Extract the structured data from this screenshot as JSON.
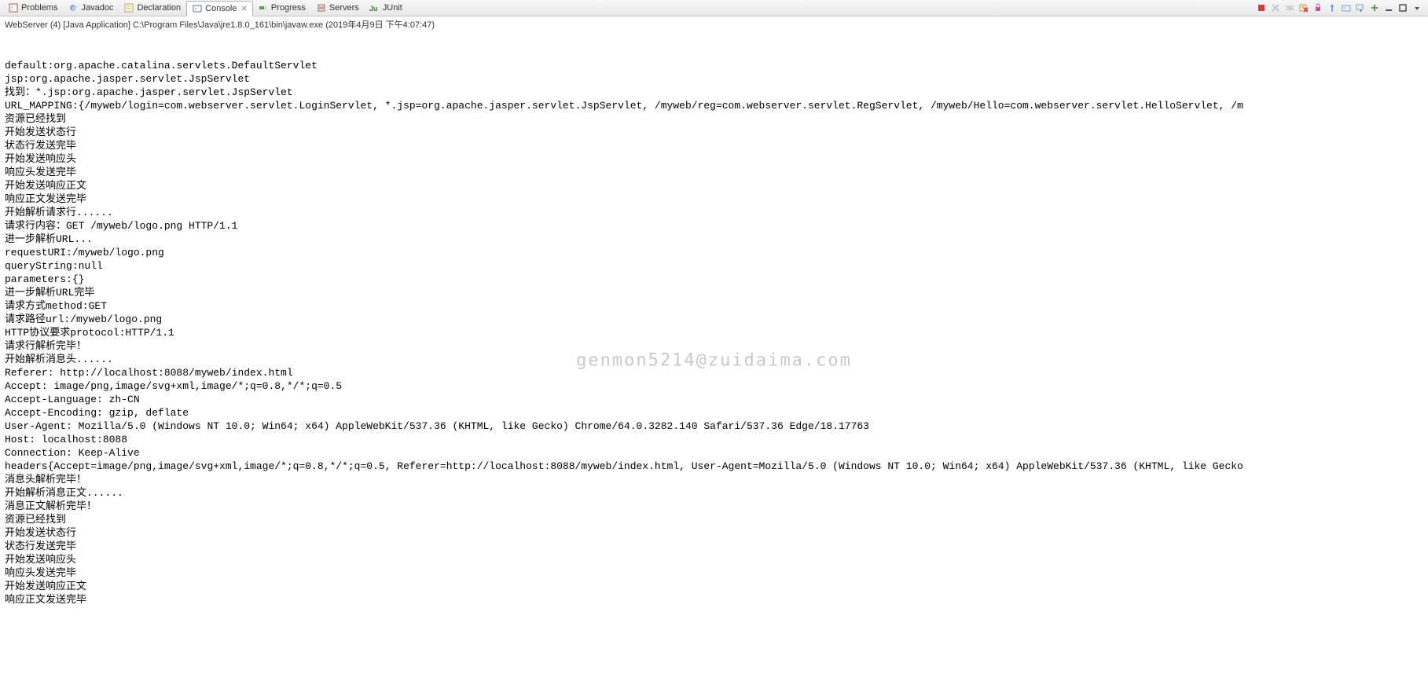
{
  "tabs": [
    {
      "label": "Problems",
      "icon": "problems-icon"
    },
    {
      "label": "Javadoc",
      "icon": "javadoc-icon"
    },
    {
      "label": "Declaration",
      "icon": "declaration-icon"
    },
    {
      "label": "Console",
      "icon": "console-icon",
      "active": true,
      "closable": true
    },
    {
      "label": "Progress",
      "icon": "progress-icon"
    },
    {
      "label": "Servers",
      "icon": "servers-icon"
    },
    {
      "label": "JUnit",
      "icon": "junit-icon"
    }
  ],
  "launch": {
    "title_prefix": "WebServer (4) [Java Application]",
    "path": "C:\\Program Files\\Java\\jre1.8.0_161\\bin\\javaw.exe",
    "timestamp": "(2019年4月9日 下午4:07:47)"
  },
  "console_lines": [
    "default:org.apache.catalina.servlets.DefaultServlet",
    "jsp:org.apache.jasper.servlet.JspServlet",
    "找到：*.jsp:org.apache.jasper.servlet.JspServlet",
    "URL_MAPPING:{/myweb/login=com.webserver.servlet.LoginServlet, *.jsp=org.apache.jasper.servlet.JspServlet, /myweb/reg=com.webserver.servlet.RegServlet, /myweb/Hello=com.webserver.servlet.HelloServlet, /m",
    "资源已经找到",
    "开始发送状态行",
    "状态行发送完毕",
    "开始发送响应头",
    "响应头发送完毕",
    "开始发送响应正文",
    "响应正文发送完毕",
    "开始解析请求行......",
    "请求行内容：GET /myweb/logo.png HTTP/1.1",
    "进一步解析URL...",
    "requestURI:/myweb/logo.png",
    "queryString:null",
    "parameters:{}",
    "进一步解析URL完毕",
    "请求方式method:GET",
    "请求路径url:/myweb/logo.png",
    "HTTP协议要求protocol:HTTP/1.1",
    "请求行解析完毕！",
    "开始解析消息头......",
    "Referer: http://localhost:8088/myweb/index.html",
    "Accept: image/png,image/svg+xml,image/*;q=0.8,*/*;q=0.5",
    "Accept-Language: zh-CN",
    "Accept-Encoding: gzip, deflate",
    "User-Agent: Mozilla/5.0 (Windows NT 10.0; Win64; x64) AppleWebKit/537.36 (KHTML, like Gecko) Chrome/64.0.3282.140 Safari/537.36 Edge/18.17763",
    "Host: localhost:8088",
    "Connection: Keep-Alive",
    "headers{Accept=image/png,image/svg+xml,image/*;q=0.8,*/*;q=0.5, Referer=http://localhost:8088/myweb/index.html, User-Agent=Mozilla/5.0 (Windows NT 10.0; Win64; x64) AppleWebKit/537.36 (KHTML, like Gecko",
    "消息头解析完毕！",
    "开始解析消息正文......",
    "消息正文解析完毕！",
    "资源已经找到",
    "开始发送状态行",
    "状态行发送完毕",
    "开始发送响应头",
    "响应头发送完毕",
    "开始发送响应正文",
    "响应正文发送完毕"
  ],
  "watermark": "genmon5214@zuidaima.com",
  "toolbar_icons": [
    {
      "name": "terminate-icon",
      "color": "#d43c3c"
    },
    {
      "name": "remove-launch-icon",
      "color": "#888888",
      "disabled": true
    },
    {
      "name": "remove-all-terminated-icon",
      "color": "#888888",
      "disabled": true
    },
    {
      "name": "clear-icon",
      "color": "#c9a84a"
    },
    {
      "name": "scroll-lock-icon",
      "color": "#b55da0"
    },
    {
      "name": "pin-console-icon",
      "color": "#5a8ed6"
    },
    {
      "name": "display-selected-console-icon",
      "color": "#6aa8de"
    },
    {
      "name": "open-console-dropdown-icon",
      "color": "#6aa8de"
    },
    {
      "name": "new-console-view-icon",
      "color": "#5aa05a"
    },
    {
      "name": "minimize-icon",
      "color": "#555"
    },
    {
      "name": "maximize-icon",
      "color": "#555"
    },
    {
      "name": "view-menu-icon",
      "color": "#555"
    }
  ]
}
